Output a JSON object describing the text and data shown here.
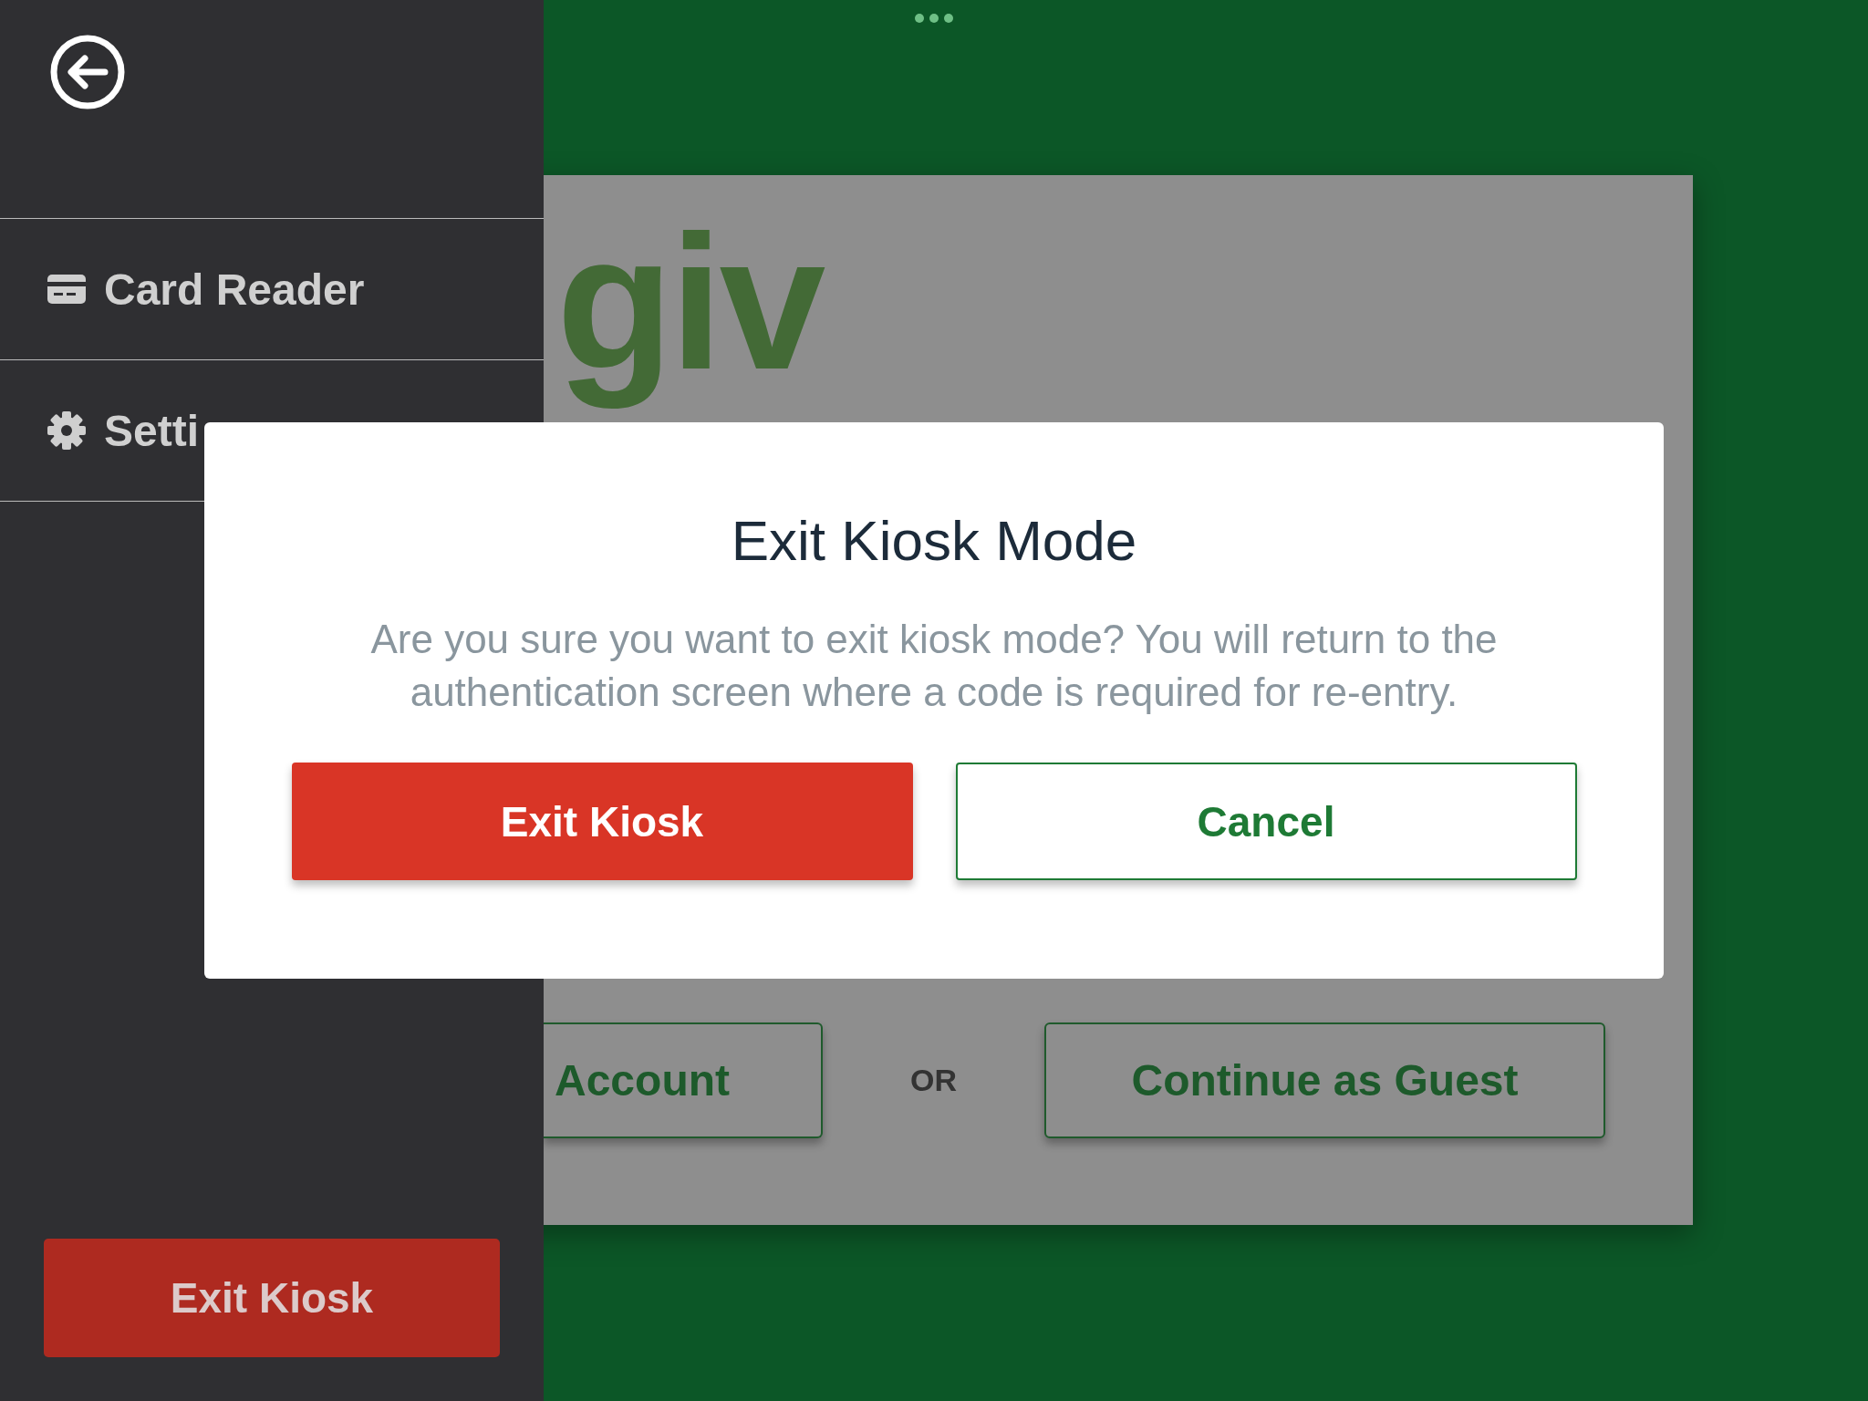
{
  "sidebar": {
    "items": [
      {
        "label": "Card Reader",
        "kind": "card"
      },
      {
        "label": "Setti",
        "kind": "settings"
      }
    ],
    "exit_button": "Exit Kiosk"
  },
  "background": {
    "logo": "giv",
    "buttons": [
      "Account",
      "Continue as Guest"
    ],
    "or_label": "OR"
  },
  "dialog": {
    "title": "Exit Kiosk Mode",
    "message": "Are you sure you want to exit kiosk mode? You will return to the authentication screen where a code is required for re-entry.",
    "buttons": [
      {
        "label": "Exit Kiosk",
        "kind": "danger"
      },
      {
        "label": "Cancel",
        "kind": "outline"
      }
    ]
  }
}
